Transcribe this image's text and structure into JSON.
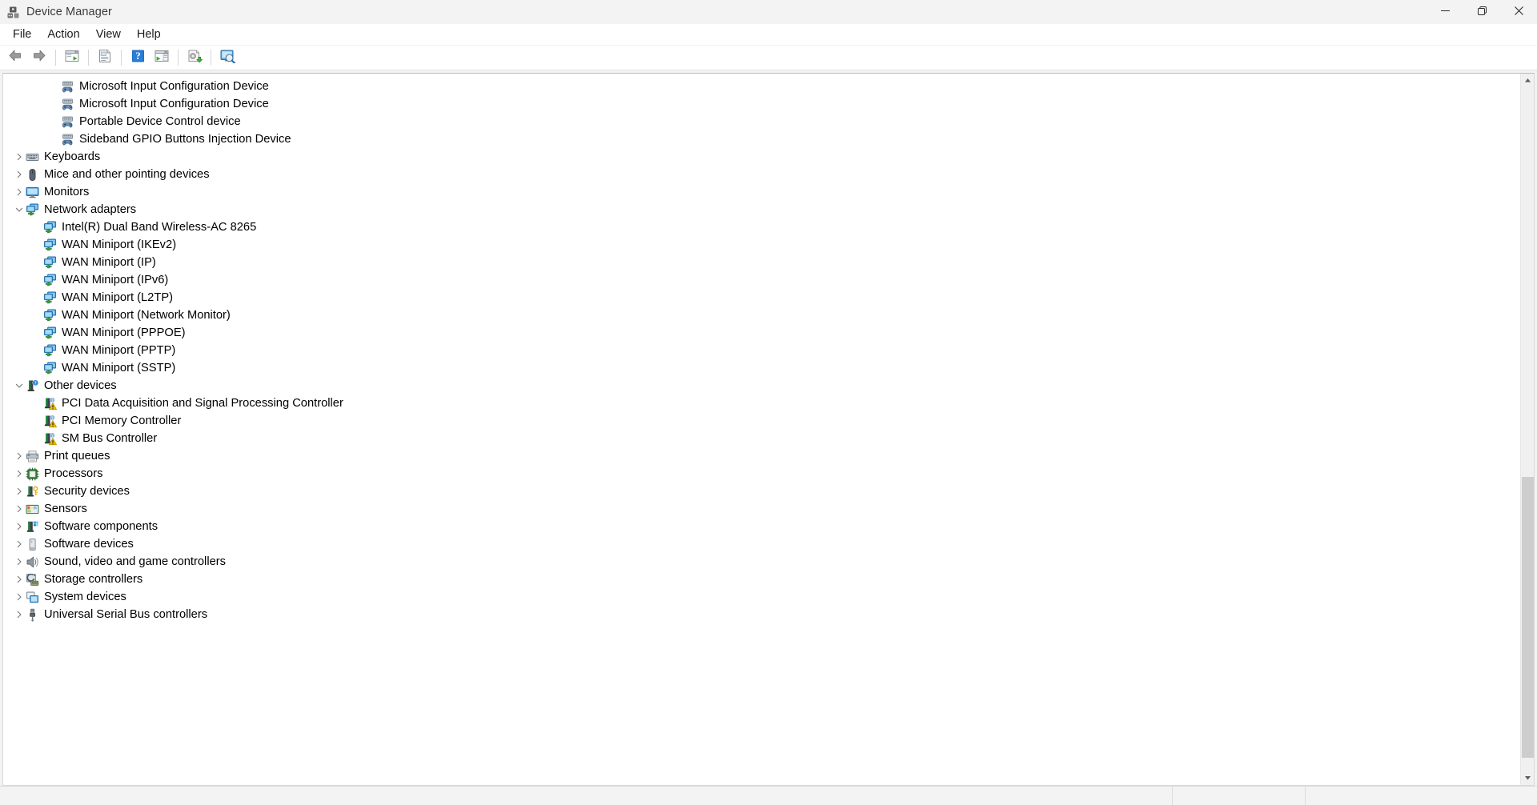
{
  "window": {
    "title": "Device Manager",
    "app_icon": "device-manager-icon",
    "caption": {
      "minimize": "—",
      "maximize": "❐",
      "close": "✕"
    }
  },
  "menubar": {
    "items": [
      {
        "label": "File"
      },
      {
        "label": "Action"
      },
      {
        "label": "View"
      },
      {
        "label": "Help"
      }
    ]
  },
  "toolbar": {
    "buttons": [
      {
        "name": "back-button",
        "icon": "back-arrow-icon",
        "tooltip": "Back"
      },
      {
        "name": "forward-button",
        "icon": "forward-arrow-icon",
        "tooltip": "Forward"
      },
      {
        "name": "separator-1",
        "icon": "separator"
      },
      {
        "name": "show-hide-console-tree-button",
        "icon": "console-tree-icon",
        "tooltip": "Show/Hide Console Tree"
      },
      {
        "name": "separator-2",
        "icon": "separator"
      },
      {
        "name": "properties-button",
        "icon": "properties-icon",
        "tooltip": "Properties"
      },
      {
        "name": "separator-3",
        "icon": "separator"
      },
      {
        "name": "help-button",
        "icon": "help-question-icon",
        "tooltip": "Help"
      },
      {
        "name": "show-hide-action-pane-button",
        "icon": "action-pane-icon",
        "tooltip": "Show/Hide Action Pane"
      },
      {
        "name": "separator-4",
        "icon": "separator"
      },
      {
        "name": "update-driver-button",
        "icon": "update-driver-icon",
        "tooltip": "Update driver"
      },
      {
        "name": "separator-5",
        "icon": "separator"
      },
      {
        "name": "scan-for-hardware-changes-button",
        "icon": "scan-hardware-icon",
        "tooltip": "Scan for hardware changes"
      }
    ]
  },
  "tree": {
    "rows": [
      {
        "label": "Microsoft Input Configuration Device",
        "icon": "hid-device-icon",
        "indent": 3,
        "twisty": "none"
      },
      {
        "label": "Microsoft Input Configuration Device",
        "icon": "hid-device-icon",
        "indent": 3,
        "twisty": "none"
      },
      {
        "label": "Portable Device Control device",
        "icon": "hid-device-icon",
        "indent": 3,
        "twisty": "none"
      },
      {
        "label": "Sideband GPIO Buttons Injection Device",
        "icon": "hid-device-icon",
        "indent": 3,
        "twisty": "none"
      },
      {
        "label": "Keyboards",
        "icon": "keyboard-icon",
        "indent": 1,
        "twisty": "collapsed"
      },
      {
        "label": "Mice and other pointing devices",
        "icon": "mouse-icon",
        "indent": 1,
        "twisty": "collapsed"
      },
      {
        "label": "Monitors",
        "icon": "monitor-icon",
        "indent": 1,
        "twisty": "collapsed"
      },
      {
        "label": "Network adapters",
        "icon": "network-adapter-icon",
        "indent": 1,
        "twisty": "expanded"
      },
      {
        "label": "Intel(R) Dual Band Wireless-AC 8265",
        "icon": "network-adapter-icon",
        "indent": 2,
        "twisty": "none"
      },
      {
        "label": "WAN Miniport (IKEv2)",
        "icon": "network-adapter-icon",
        "indent": 2,
        "twisty": "none"
      },
      {
        "label": "WAN Miniport (IP)",
        "icon": "network-adapter-icon",
        "indent": 2,
        "twisty": "none"
      },
      {
        "label": "WAN Miniport (IPv6)",
        "icon": "network-adapter-icon",
        "indent": 2,
        "twisty": "none"
      },
      {
        "label": "WAN Miniport (L2TP)",
        "icon": "network-adapter-icon",
        "indent": 2,
        "twisty": "none"
      },
      {
        "label": "WAN Miniport (Network Monitor)",
        "icon": "network-adapter-icon",
        "indent": 2,
        "twisty": "none"
      },
      {
        "label": "WAN Miniport (PPPOE)",
        "icon": "network-adapter-icon",
        "indent": 2,
        "twisty": "none"
      },
      {
        "label": "WAN Miniport (PPTP)",
        "icon": "network-adapter-icon",
        "indent": 2,
        "twisty": "none"
      },
      {
        "label": "WAN Miniport (SSTP)",
        "icon": "network-adapter-icon",
        "indent": 2,
        "twisty": "none"
      },
      {
        "label": "Other devices",
        "icon": "unknown-device-icon",
        "indent": 1,
        "twisty": "expanded"
      },
      {
        "label": "PCI Data Acquisition and Signal Processing Controller",
        "icon": "unknown-device-warning-icon",
        "indent": 2,
        "twisty": "none"
      },
      {
        "label": "PCI Memory Controller",
        "icon": "unknown-device-warning-icon",
        "indent": 2,
        "twisty": "none"
      },
      {
        "label": "SM Bus Controller",
        "icon": "unknown-device-warning-icon",
        "indent": 2,
        "twisty": "none"
      },
      {
        "label": "Print queues",
        "icon": "printer-icon",
        "indent": 1,
        "twisty": "collapsed"
      },
      {
        "label": "Processors",
        "icon": "processor-icon",
        "indent": 1,
        "twisty": "collapsed"
      },
      {
        "label": "Security devices",
        "icon": "security-device-icon",
        "indent": 1,
        "twisty": "collapsed"
      },
      {
        "label": "Sensors",
        "icon": "sensor-icon",
        "indent": 1,
        "twisty": "collapsed"
      },
      {
        "label": "Software components",
        "icon": "software-component-icon",
        "indent": 1,
        "twisty": "collapsed"
      },
      {
        "label": "Software devices",
        "icon": "software-device-icon",
        "indent": 1,
        "twisty": "collapsed"
      },
      {
        "label": "Sound, video and game controllers",
        "icon": "speaker-icon",
        "indent": 1,
        "twisty": "collapsed"
      },
      {
        "label": "Storage controllers",
        "icon": "storage-controller-icon",
        "indent": 1,
        "twisty": "collapsed"
      },
      {
        "label": "System devices",
        "icon": "system-device-icon",
        "indent": 1,
        "twisty": "collapsed"
      },
      {
        "label": "Universal Serial Bus controllers",
        "icon": "usb-controller-icon",
        "indent": 1,
        "twisty": "collapsed"
      }
    ]
  },
  "scrollbar": {
    "up_arrow": "scroll-up-arrow-icon",
    "down_arrow": "scroll-down-arrow-icon",
    "thumb_top_pct": 57,
    "thumb_height_pct": 41
  },
  "statusbar": {
    "cells": [
      "",
      "",
      ""
    ]
  },
  "colors": {
    "accent_blue": "#3d9ae2",
    "warning_yellow": "#f2c200",
    "window_bg": "#f3f3f3",
    "pane_bg": "#ffffff",
    "text": "#000000",
    "title_text": "#3b3b3b",
    "scroll_thumb": "#cdcdcd"
  }
}
